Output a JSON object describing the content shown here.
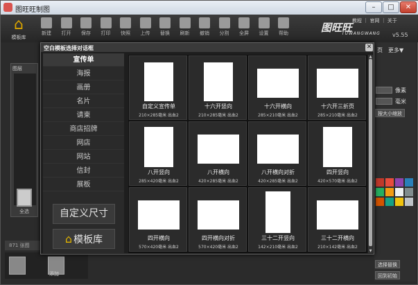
{
  "window": {
    "title": "图旺旺制图",
    "min": "–",
    "max": "□",
    "close": "✕"
  },
  "toolbar": {
    "home_label": "模板库",
    "tools": [
      {
        "label": "新建",
        "icon": "new-file-icon"
      },
      {
        "label": "打开",
        "icon": "open-folder-icon"
      },
      {
        "label": "保存",
        "icon": "save-icon"
      },
      {
        "label": "打印",
        "icon": "print-icon"
      },
      {
        "label": "快照",
        "icon": "camera-icon"
      },
      {
        "label": "上传",
        "icon": "upload-icon"
      },
      {
        "label": "替换",
        "icon": "replace-icon"
      },
      {
        "label": "刷新",
        "icon": "refresh-icon"
      },
      {
        "label": "撤销",
        "icon": "undo-icon"
      },
      {
        "label": "分割",
        "icon": "split-icon"
      },
      {
        "label": "全屏",
        "icon": "fullscreen-icon"
      },
      {
        "label": "设置",
        "icon": "gear-icon"
      },
      {
        "label": "帮助",
        "icon": "help-icon"
      }
    ],
    "top_links": "教程 ｜ 官网 ｜ 关于",
    "logo_text": "图旺旺",
    "logo_sub": "TUWANGWANG",
    "version": "v5.55"
  },
  "left_panel": {
    "label": "图层",
    "all_label": "全选"
  },
  "bottom": {
    "strip_label": "871 张图",
    "thumb_label": "添加"
  },
  "right_panel": {
    "tab_label": "页",
    "more": "更多▼",
    "unit1": "像素",
    "unit2": "毫米",
    "scale_btn": "按大小缩放",
    "btn1": "选择替换",
    "btn2": "回到初始"
  },
  "colors": {
    "swatches": [
      "#c0392b",
      "#e74c3c",
      "#8e44ad",
      "#2980b9",
      "#27ae60",
      "#f39c12",
      "#ecf0f1",
      "#7f8c8d",
      "#d35400",
      "#16a085",
      "#f1c40f",
      "#bdc3c7"
    ]
  },
  "dialog": {
    "title": "空白模板选择对话框",
    "close": "✕",
    "categories": [
      "宣传单",
      "海报",
      "画册",
      "名片",
      "请柬",
      "商店招牌",
      "网店",
      "网站",
      "信封",
      "展板"
    ],
    "custom_size": "自定义尺寸",
    "template_lib": "模板库",
    "templates": [
      {
        "name": "自定义宣传单",
        "size": "210×285毫米  出血2"
      },
      {
        "name": "十六开竖向",
        "size": "210×285毫米  出血2"
      },
      {
        "name": "十六开横向",
        "size": "285×210毫米  出血2"
      },
      {
        "name": "十六开三折页",
        "size": "285×210毫米  出血2"
      },
      {
        "name": "八开竖向",
        "size": "285×420毫米  出血2"
      },
      {
        "name": "八开横向",
        "size": "420×285毫米  出血2"
      },
      {
        "name": "八开横向对折",
        "size": "420×285毫米  出血2"
      },
      {
        "name": "四开竖向",
        "size": "420×570毫米  出血2"
      },
      {
        "name": "四开横向",
        "size": "570×420毫米  出血2"
      },
      {
        "name": "四开横向对折",
        "size": "570×420毫米  出血2"
      },
      {
        "name": "三十二开竖向",
        "size": "142×210毫米  出血2"
      },
      {
        "name": "三十二开横向",
        "size": "210×142毫米  出血2"
      }
    ]
  }
}
